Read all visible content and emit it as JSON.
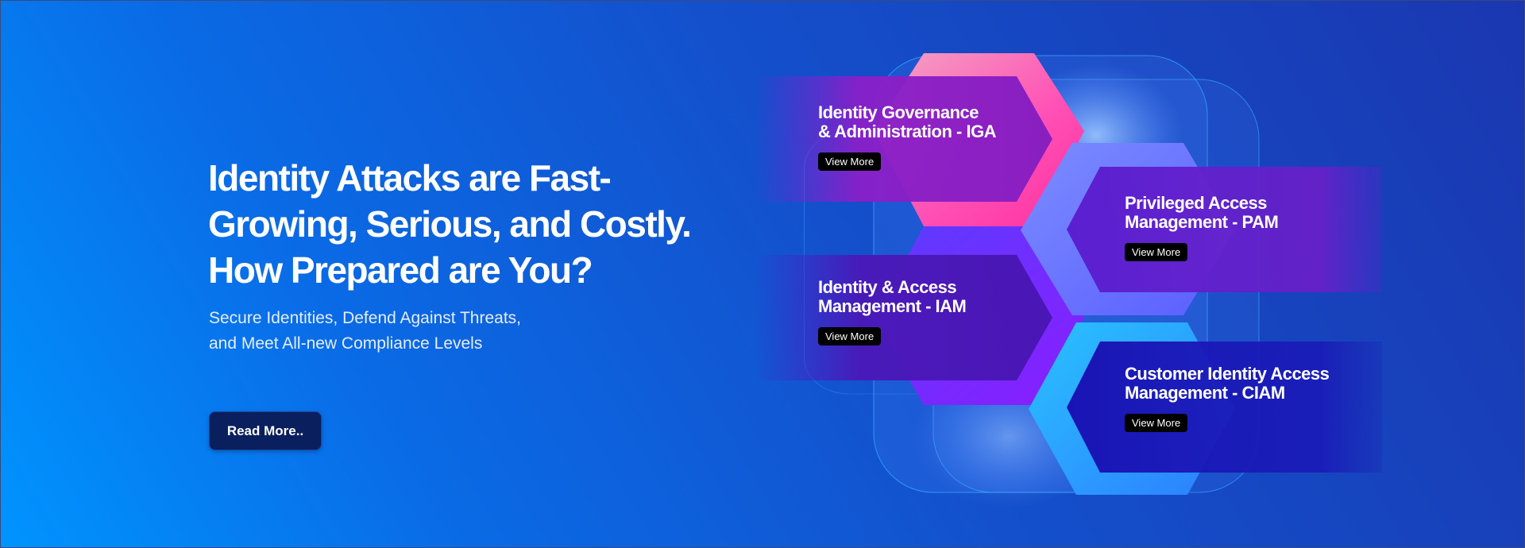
{
  "hero": {
    "title_lines": [
      "Identity Attacks are Fast-",
      "Growing, Serious, and Costly.",
      "How Prepared are You?"
    ],
    "subtitle_lines": [
      "Secure Identities, Defend Against Threats,",
      "and Meet All-new Compliance Levels"
    ],
    "button_label": "Read More.."
  },
  "cards": [
    {
      "title_lines": [
        "Identity Governance",
        "& Administration - IGA"
      ],
      "button_label": "View More"
    },
    {
      "title_lines": [
        "Privileged Access",
        "Management - PAM"
      ],
      "button_label": "View More"
    },
    {
      "title_lines": [
        "Identity & Access",
        "Management - IAM"
      ],
      "button_label": "View More"
    },
    {
      "title_lines": [
        "Customer Identity Access",
        "Management - CIAM"
      ],
      "button_label": "View More"
    }
  ],
  "colors": {
    "background_start": "#0094ff",
    "background_end": "#1a37b0",
    "button_dark": "#0a1f5e",
    "iga_accent": "#ff45b0",
    "pam_accent": "#6a7bff",
    "iam_accent": "#7a2bff",
    "ciam_accent": "#2fb6ff"
  }
}
